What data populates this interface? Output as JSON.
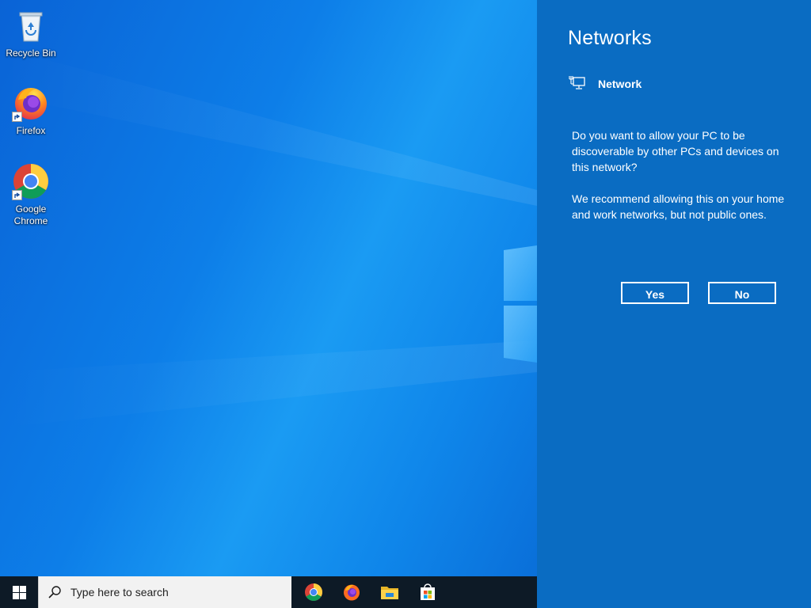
{
  "desktop": {
    "icons": [
      {
        "label": "Recycle Bin",
        "icon": "recycle-bin-icon"
      },
      {
        "label": "Firefox",
        "icon": "firefox-icon"
      },
      {
        "label": "Google Chrome",
        "icon": "chrome-icon"
      }
    ]
  },
  "networks_panel": {
    "title": "Networks",
    "network_name": "Network",
    "network_icon": "ethernet-monitor-icon",
    "prompt": "Do you want to allow your PC to be discoverable by other PCs and devices on this network?",
    "recommendation": "We recommend allowing this on your home and work networks, but not public ones.",
    "yes_label": "Yes",
    "no_label": "No",
    "background_color": "#0a6cc2"
  },
  "taskbar": {
    "start_icon": "windows-logo-icon",
    "search_placeholder": "Type here to search",
    "pinned_apps": [
      {
        "name": "Google Chrome",
        "icon": "chrome-icon"
      },
      {
        "name": "Firefox",
        "icon": "firefox-icon"
      },
      {
        "name": "File Explorer",
        "icon": "folder-icon"
      },
      {
        "name": "Microsoft Store",
        "icon": "store-bag-icon"
      }
    ],
    "background_color": "#0d1a26"
  }
}
